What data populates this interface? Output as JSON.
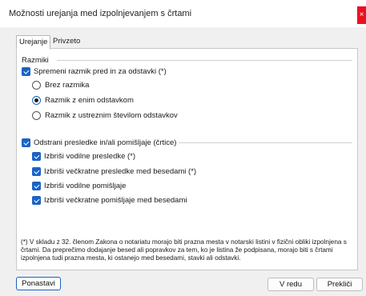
{
  "window": {
    "title": "Možnosti urejanja med izpolnjevanjem s črtami",
    "close_glyph": "×"
  },
  "tabs": [
    {
      "label": "Urejanje"
    },
    {
      "label": "Privzeto"
    }
  ],
  "spacing": {
    "heading": "Razmiki",
    "toggle_label": "Spremeni razmik pred in za odstavki (*)",
    "toggle_checked": true,
    "options": [
      {
        "label": "Brez razmika",
        "selected": false
      },
      {
        "label": "Razmik z enim odstavkom",
        "selected": true
      },
      {
        "label": "Razmik z ustreznim številom odstavkov",
        "selected": false
      }
    ]
  },
  "spaces": {
    "toggle_label": "Odstrani presledke in/ali pomišljaje (črtice)",
    "toggle_checked": true,
    "items": [
      {
        "label": "Izbriši vodilne presledke (*)",
        "checked": true
      },
      {
        "label": "Izbriši večkratne presledke med besedami (*)",
        "checked": true
      },
      {
        "label": "Izbriši vodilne pomišljaje",
        "checked": true
      },
      {
        "label": "Izbriši večkratne pomišljaje med besedami",
        "checked": true
      }
    ]
  },
  "footnote": "(*) V skladu z 32. členom Zakona o notariatu morajo biti prazna mesta v notarski listini v fizični obliki izpolnjena s črtami. Da preprečimo dodajanje besed ali popravkov za tem, ko je listina že podpisana, morajo biti s črtami izpolnjena tudi prazna mesta, ki ostanejo med besedami, stavki ali odstavki.",
  "buttons": {
    "reset": "Ponastavi",
    "ok": "V redu",
    "cancel": "Prekliči"
  }
}
